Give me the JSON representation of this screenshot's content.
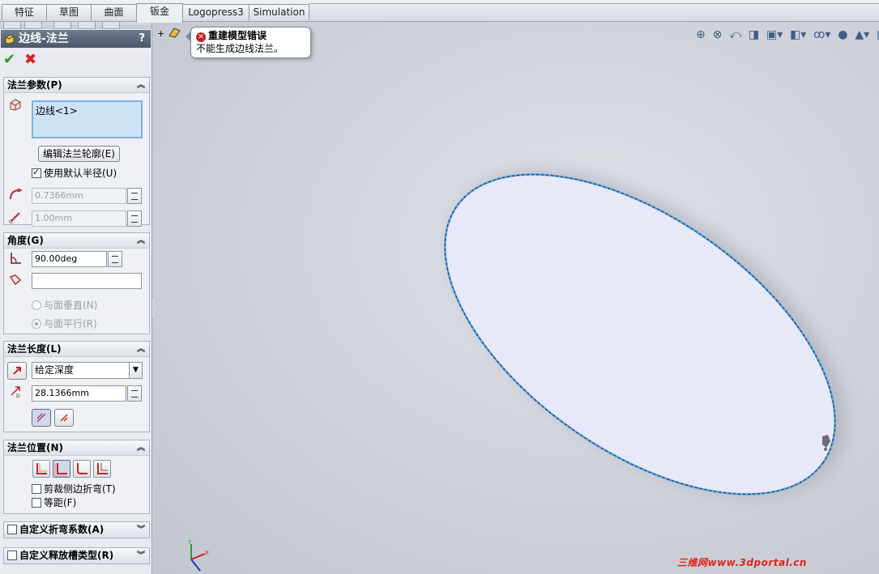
{
  "tabs": [
    {
      "label": "特征",
      "active": false
    },
    {
      "label": "草图",
      "active": false
    },
    {
      "label": "曲面",
      "active": false
    },
    {
      "label": "钣金",
      "active": true
    },
    {
      "label": "Logopress3",
      "active": false
    },
    {
      "label": "Simulation",
      "active": false
    }
  ],
  "property_manager": {
    "title": "边线-法兰",
    "help": "?",
    "ok_icon": "green-check-icon",
    "cancel_icon": "red-x-icon",
    "flange_params": {
      "header": "法兰参数(P)",
      "edge_selection": "边线<1>",
      "edit_profile_button": "编辑法兰轮廓(E)",
      "use_default_radius": {
        "label": "使用默认半径(U)",
        "checked": true
      },
      "bend_radius": "0.7366mm",
      "gap_distance": "1.00mm"
    },
    "angle": {
      "header": "角度(G)",
      "angle_value": "90.00deg",
      "reference_face": "",
      "normal_to_face": "与面垂直(N)",
      "parallel_to_face": "与面平行(R)"
    },
    "flange_length": {
      "header": "法兰长度(L)",
      "end_condition": "给定深度",
      "length_value": "28.1366mm"
    },
    "flange_position": {
      "header": "法兰位置(N)",
      "trim_side_bends": {
        "label": "剪裁侧边折弯(T)",
        "checked": false
      },
      "offset": {
        "label": "等距(F)",
        "checked": false
      }
    },
    "custom_bend_allowance": {
      "label": "自定义折弯系数(A)",
      "checked": false
    },
    "custom_relief_type": {
      "label": "自定义释放槽类型(R)",
      "checked": false
    }
  },
  "error_bubble": {
    "title": "重建模型错误",
    "message": "不能生成边线法兰。"
  },
  "tree_stub": "+",
  "watermark": "三维网www.3dportal.cn",
  "colors": {
    "title_bar": "#55607a",
    "selection_box": "#cfe3f7",
    "ellipse_fill": "#e8e9f8",
    "ellipse_edge": "#5aa3e6",
    "error_red": "#c9221f",
    "watermark": "#e2231a"
  }
}
